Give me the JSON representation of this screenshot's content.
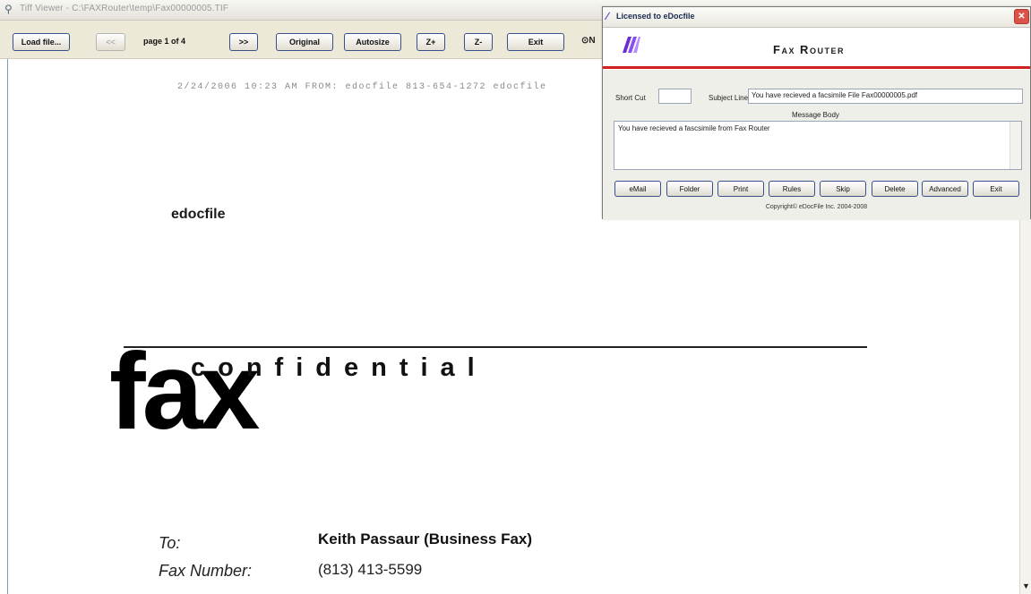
{
  "viewer": {
    "title": "Tiff Viewer - C:\\FAXRouter\\temp\\Fax00000005.TIF",
    "toolbar": {
      "load_file": "Load file...",
      "prev": "<<",
      "page_label": "page 1 of 4",
      "next": ">>",
      "original": "Original",
      "autosize": "Autosize",
      "zoom_in": "Z+",
      "zoom_out": "Z-",
      "exit": "Exit",
      "radio_fragment": "⊙N"
    }
  },
  "document": {
    "header_line": "2/24/2006  10:23 AM   FROM: edocfile 813-654-1272 edocfile",
    "sender": "edocfile",
    "fax_word": "fax",
    "confidential_word": "confidential",
    "to_label": "To:",
    "to_value": "Keith Passaur (Business Fax)",
    "fax_number_label": "Fax Number:",
    "fax_number_value": "(813) 413-5599"
  },
  "dialog": {
    "title": "Licensed to eDocfile",
    "close": "✕",
    "app_title": "Fax Router",
    "short_cut_label": "Short Cut",
    "short_cut_value": "",
    "subject_label": "Subject Line",
    "subject_value": "You have recieved a facsimile File Fax00000005.pdf",
    "message_body_label": "Message Body",
    "message_body_value": "You have recieved a fascsimile from Fax Router",
    "buttons": {
      "email": "eMail",
      "folder": "Folder",
      "print": "Print",
      "rules": "Rules",
      "skip": "Skip",
      "delete": "Delete",
      "advanced": "Advanced",
      "exit": "Exit"
    },
    "copyright": "Copyright© eDocFile Inc. 2004-2008"
  },
  "colors": {
    "accent_red": "#d21f1f",
    "logo_purple": "#6b2fd1",
    "button_border": "#3b4f8a"
  }
}
